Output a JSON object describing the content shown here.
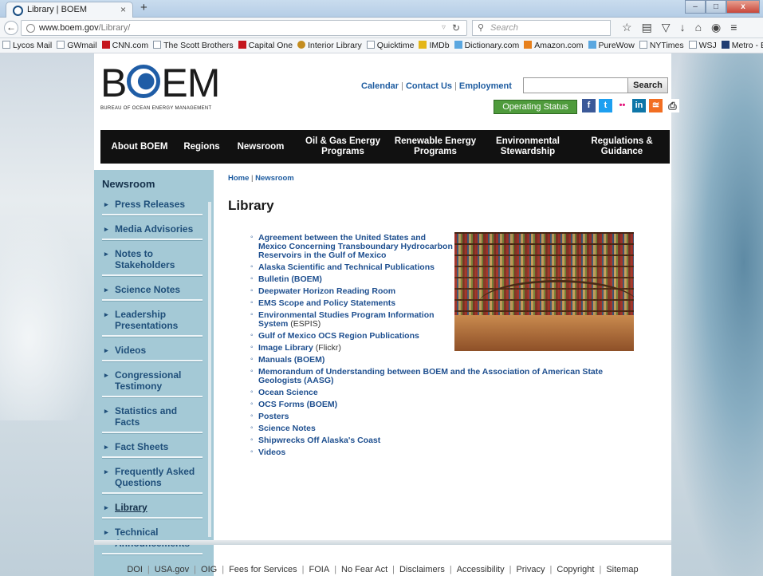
{
  "browser": {
    "tab_title": "Library | BOEM",
    "tab_close": "×",
    "new_tab": "+",
    "url_host": "www.boem.gov",
    "url_path": "/Library/",
    "search_placeholder": "Search",
    "bookmarks": [
      {
        "label": "Lycos Mail",
        "icon": "lycos-icon"
      },
      {
        "label": "GWmail",
        "icon": "page-icon"
      },
      {
        "label": "CNN.com",
        "icon": "cnn-icon"
      },
      {
        "label": "The Scott Brothers",
        "icon": "s-icon"
      },
      {
        "label": "Capital One",
        "icon": "capital-one-icon"
      },
      {
        "label": "Interior Library",
        "icon": "interior-icon"
      },
      {
        "label": "Quicktime",
        "icon": "page-icon"
      },
      {
        "label": "IMDb",
        "icon": "imdb-icon"
      },
      {
        "label": "Dictionary.com",
        "icon": "dictionary-icon"
      },
      {
        "label": "Amazon.com",
        "icon": "amazon-icon"
      },
      {
        "label": "PureWow",
        "icon": "purewow-icon"
      },
      {
        "label": "NYTimes",
        "icon": "nytimes-icon"
      },
      {
        "label": "WSJ",
        "icon": "wsj-icon"
      },
      {
        "label": "Metro - Bus - Better Bus",
        "icon": "metro-icon"
      }
    ]
  },
  "site": {
    "logo_text": "BOEM",
    "logo_subtitle": "Bureau of Ocean Energy Management",
    "top_links": [
      "Calendar",
      "Contact Us",
      "Employment"
    ],
    "search_button": "Search",
    "operating_status": "Operating Status",
    "social": [
      "f",
      "t",
      "••",
      "in",
      "rss",
      "⎙"
    ],
    "nav": [
      "About BOEM",
      "Regions",
      "Newsroom",
      "Oil & Gas Energy Programs",
      "Renewable Energy Programs",
      "Environmental Stewardship",
      "Regulations & Guidance"
    ]
  },
  "sidebar": {
    "heading": "Newsroom",
    "items": [
      "Press Releases",
      "Media Advisories",
      "Notes to Stakeholders",
      "Science Notes",
      "Leadership Presentations",
      "Videos",
      "Congressional Testimony",
      "Statistics and Facts",
      "Fact Sheets",
      "Frequently Asked Questions",
      "Library",
      "Technical Announcements"
    ],
    "active": "Library"
  },
  "content": {
    "breadcrumb": [
      "Home",
      "Newsroom"
    ],
    "title": "Library",
    "links": [
      {
        "text": "Agreement between the United States and Mexico Concerning Transboundary Hydrocarbon Reservoirs in the Gulf of Mexico",
        "note": ""
      },
      {
        "text": "Alaska Scientific and Technical Publications",
        "note": ""
      },
      {
        "text": "Bulletin (BOEM)",
        "note": ""
      },
      {
        "text": "Deepwater Horizon Reading Room",
        "note": ""
      },
      {
        "text": "EMS Scope and Policy Statements",
        "note": ""
      },
      {
        "text": "Environmental Studies Program Information System",
        "note": " (ESPIS)"
      },
      {
        "text": "Gulf of Mexico OCS Region Publications",
        "note": ""
      },
      {
        "text": "Image Library",
        "note": " (Flickr)"
      },
      {
        "text": "Manuals (BOEM)",
        "note": ""
      },
      {
        "text": "Memorandum of Understanding between BOEM and the Association of American State Geologists (AASG)",
        "note": ""
      },
      {
        "text": "Ocean Science",
        "note": ""
      },
      {
        "text": "OCS Forms (BOEM)",
        "note": ""
      },
      {
        "text": "Posters",
        "note": ""
      },
      {
        "text": "Science Notes",
        "note": ""
      },
      {
        "text": "Shipwrecks Off Alaska's Coast",
        "note": ""
      },
      {
        "text": "Videos",
        "note": ""
      }
    ]
  },
  "footer": [
    "DOI",
    "USA.gov",
    "OIG",
    "Fees for Services",
    "FOIA",
    "No Fear Act",
    "Disclaimers",
    "Accessibility",
    "Privacy",
    "Copyright",
    "Sitemap"
  ],
  "colors": {
    "link": "#1e4f8f",
    "sidebar": "#a4c9d6",
    "nav": "#111111",
    "status": "#4f9b3c"
  }
}
